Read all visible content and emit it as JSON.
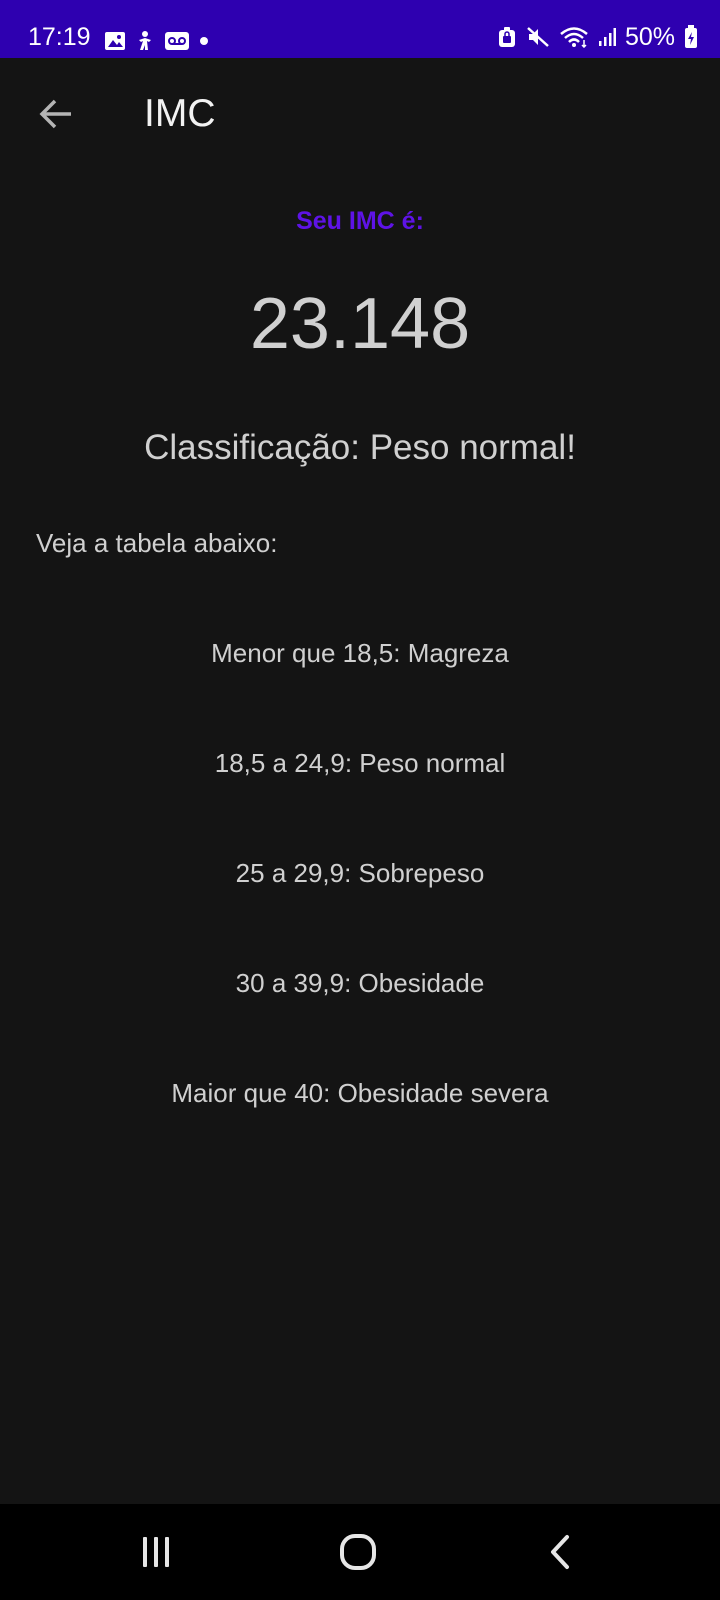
{
  "status_bar": {
    "time": "17:19",
    "battery": "50%",
    "left_icons": [
      "image-icon",
      "accessibility-icon",
      "voicemail-icon",
      "notification-dot-icon"
    ],
    "right_icons": [
      "lock-battery-icon",
      "mute-icon",
      "wifi-icon",
      "signal-icon",
      "battery-icon"
    ],
    "background": "#2e00b0"
  },
  "app_bar": {
    "title": "IMC",
    "back_icon": "arrow-back-icon"
  },
  "result": {
    "label": "Seu IMC é:",
    "value": "23.148",
    "classification": "Classificação: Peso normal!",
    "accent_color": "#5e13e6"
  },
  "table": {
    "intro": "Veja a tabela abaixo:",
    "rows": [
      "Menor que 18,5: Magreza",
      "18,5 a 24,9: Peso normal",
      "25 a 29,9: Sobrepeso",
      "30 a 39,9: Obesidade",
      "Maior que 40: Obesidade severa"
    ]
  },
  "nav_bar": {
    "buttons": [
      "recents-icon",
      "home-icon",
      "back-icon"
    ]
  },
  "colors": {
    "background": "#141414",
    "text": "#d0d0d0",
    "nav_background": "#000000"
  }
}
